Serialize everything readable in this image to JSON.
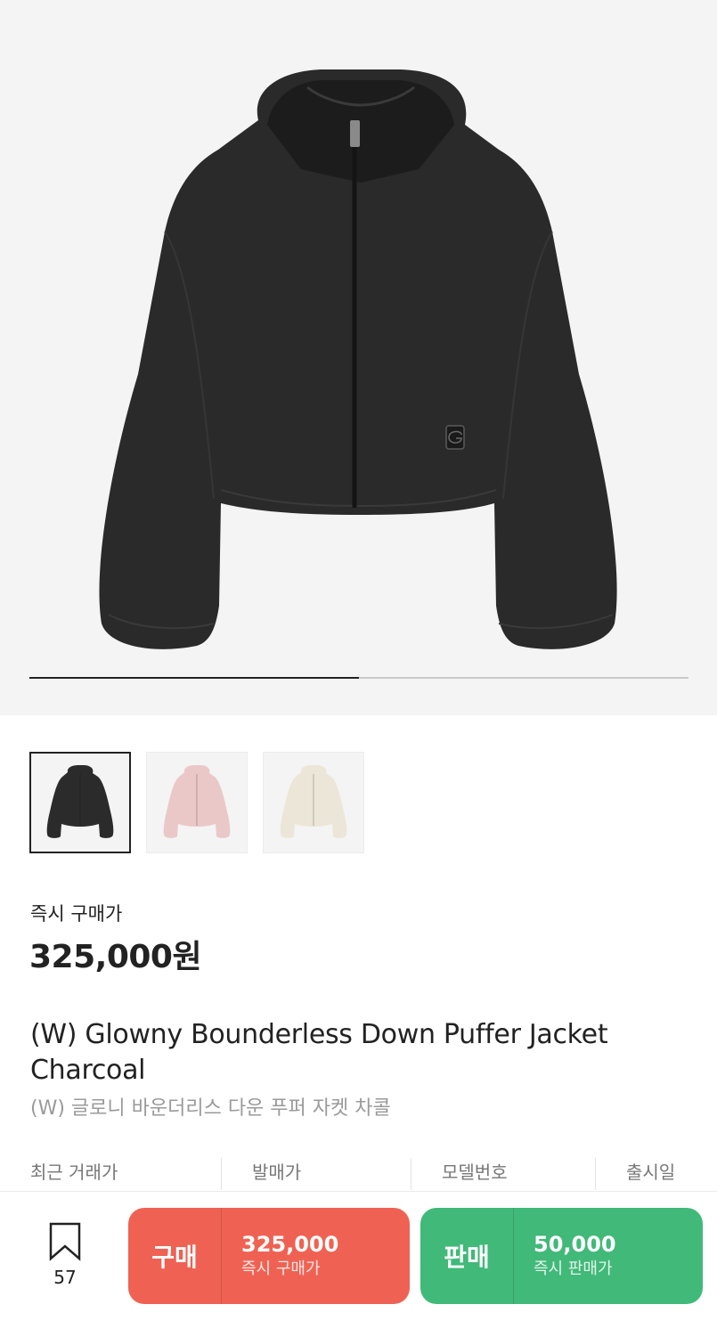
{
  "gallery": {
    "progress": 0.5,
    "thumbnails": [
      {
        "name": "charcoal",
        "color": "#2b2b2b",
        "selected": true
      },
      {
        "name": "pink",
        "color": "#ebc8c8",
        "selected": false
      },
      {
        "name": "ivory",
        "color": "#ece6d8",
        "selected": false
      }
    ]
  },
  "price": {
    "label": "즉시 구매가",
    "value": "325,000원"
  },
  "product": {
    "title": "(W) Glowny Bounderless Down Puffer Jacket Charcoal",
    "subtitle": "(W) 글로니 바운더리스 다운 푸퍼 자켓 차콜"
  },
  "info_headers": [
    "최근 거래가",
    "발매가",
    "모델번호",
    "출시일"
  ],
  "bottom_bar": {
    "wish_count": "57",
    "buy": {
      "label": "구매",
      "price": "325,000",
      "sub": "즉시 구매가",
      "color": "#ef6253"
    },
    "sell": {
      "label": "판매",
      "price": "50,000",
      "sub": "즉시 판매가",
      "color": "#41b979"
    }
  }
}
